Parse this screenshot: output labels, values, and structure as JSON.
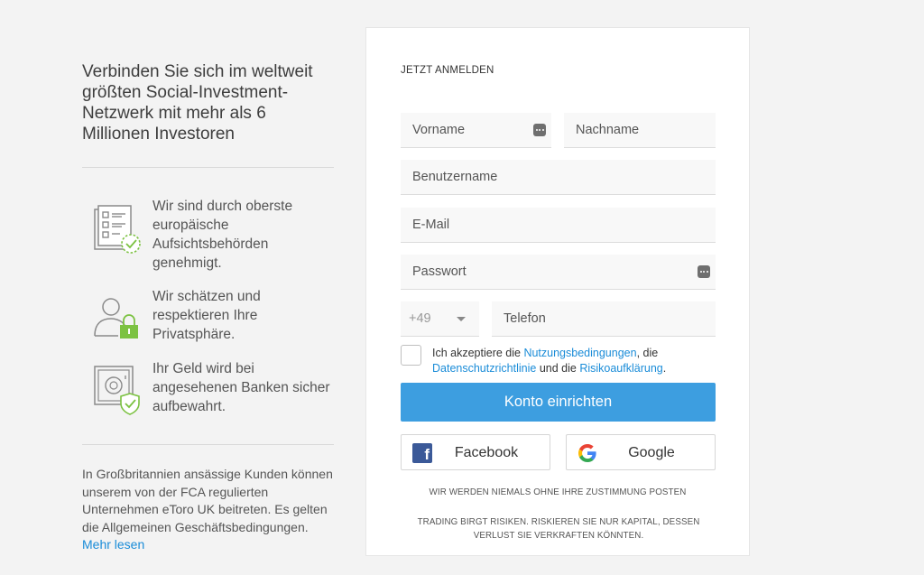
{
  "left": {
    "headline": "Verbinden Sie sich im weltweit größten Social-Investment-Netzwerk mit mehr als 6 Millionen Investoren",
    "features": [
      {
        "icon": "checklist-icon",
        "text": "Wir sind durch oberste europäische Aufsichtsbehörden genehmigt."
      },
      {
        "icon": "user-lock-icon",
        "text": "Wir schätzen und respektieren Ihre Privatsphäre."
      },
      {
        "icon": "safe-shield-icon",
        "text": "Ihr Geld wird bei angesehenen Banken sicher aufbewahrt."
      }
    ],
    "note": "In Großbritannien ansässige Kunden können unserem von der FCA regulierten Unternehmen eToro UK beitreten. Es gelten die Allgemeinen Geschäftsbedingungen.",
    "note_link": "Mehr lesen"
  },
  "form": {
    "title": "JETZT ANMELDEN",
    "first_name_placeholder": "Vorname",
    "last_name_placeholder": "Nachname",
    "username_placeholder": "Benutzername",
    "email_placeholder": "E-Mail",
    "password_placeholder": "Passwort",
    "country_code": "+49",
    "phone_placeholder": "Telefon",
    "terms": {
      "prefix": "Ich akzeptiere die ",
      "link1": "Nutzungsbedingungen",
      "sep1": ", die ",
      "link2": "Datenschutzrichtlinie",
      "sep2": " und die ",
      "link3": "Risikoaufklärung",
      "suffix": "."
    },
    "submit_label": "Konto einrichten",
    "facebook_label": "Facebook",
    "google_label": "Google",
    "disclaimer1": "WIR WERDEN NIEMALS OHNE IHRE ZUSTIMMUNG POSTEN",
    "disclaimer2": "TRADING BIRGT RISIKEN. RISKIEREN SIE NUR KAPITAL, DESSEN VERLUST SIE VERKRAFTEN KÖNNTEN."
  },
  "colors": {
    "accent": "#3d9ee0",
    "link": "#1a8cd8",
    "facebook": "#3b5998",
    "icon_green": "#7cc242"
  }
}
